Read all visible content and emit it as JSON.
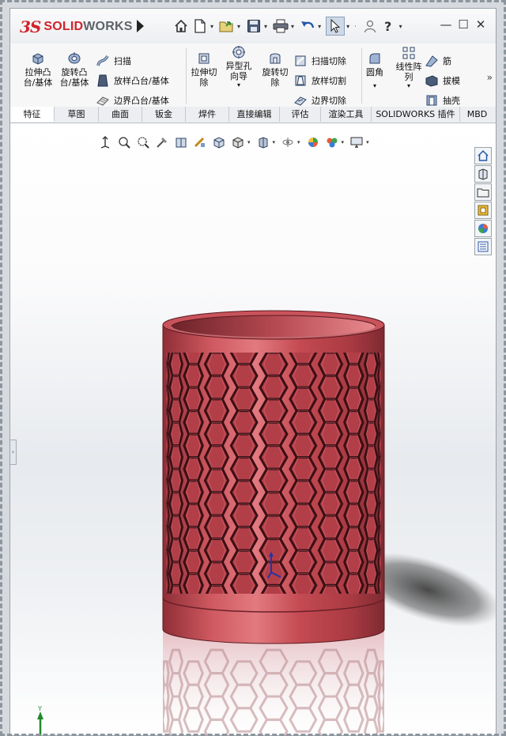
{
  "app": {
    "brand_ds": "3S",
    "brand_solid": "SOLID",
    "brand_works": "WORKS"
  },
  "ribbon": {
    "extrude_boss": "拉伸凸\n台/基体",
    "revolve_boss": "旋转凸\n台/基体",
    "sweep": "扫描",
    "loft_boss": "放样凸台/基体",
    "boundary_boss": "边界凸台/基体",
    "extrude_cut": "拉伸切\n除",
    "hole_wizard": "异型孔\n向导",
    "revolve_cut": "旋转切\n除",
    "swept_cut": "扫描切除",
    "lofted_cut": "放样切割",
    "boundary_cut": "边界切除",
    "fillet": "圆角",
    "linear_pattern": "线性阵\n列",
    "rib": "筋",
    "draft": "拔模",
    "shell": "抽壳"
  },
  "tabs": [
    {
      "label": "特征",
      "active": true
    },
    {
      "label": "草图",
      "active": false
    },
    {
      "label": "曲面",
      "active": false
    },
    {
      "label": "钣金",
      "active": false
    },
    {
      "label": "焊件",
      "active": false
    },
    {
      "label": "直接编辑",
      "active": false
    },
    {
      "label": "评估",
      "active": false
    },
    {
      "label": "渲染工具",
      "active": false
    },
    {
      "label": "SOLIDWORKS 插件",
      "active": false
    },
    {
      "label": "MBD",
      "active": false
    }
  ],
  "model": {
    "body_color": "#c74a52",
    "name": "hexagonal pen holder"
  },
  "triad": {
    "y_label": "Y"
  },
  "icons": {
    "quick_access": [
      "home-icon",
      "new-document-icon",
      "open-icon",
      "save-icon",
      "print-icon",
      "undo-icon",
      "select-icon",
      "user-icon",
      "help-icon"
    ],
    "heads_up": [
      "view-orientation-icon",
      "zoom-to-fit-icon",
      "zoom-to-area-icon",
      "previous-view-icon",
      "section-view-icon",
      "dynamic-annotation-icon",
      "view-cube-icon",
      "display-style-icon",
      "hide-show-icon",
      "edit-appearance-icon",
      "apply-scene-icon",
      "view-settings-icon"
    ],
    "task_pane": [
      "home-pane-icon",
      "design-library-icon",
      "file-explorer-icon",
      "view-palette-icon",
      "appearances-icon",
      "custom-properties-icon"
    ]
  }
}
